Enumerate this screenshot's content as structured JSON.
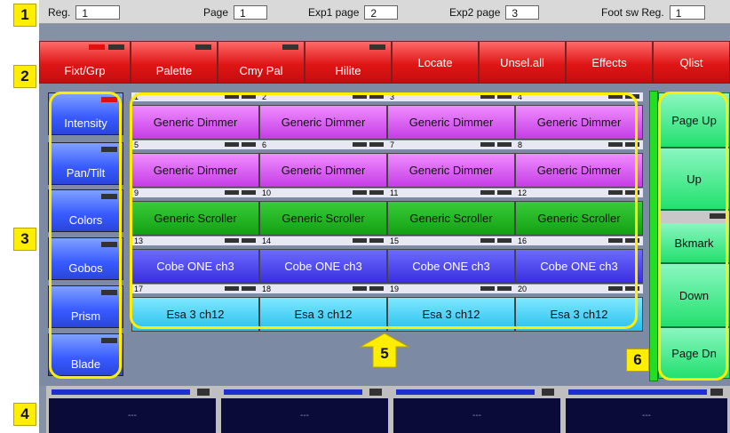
{
  "topbar": {
    "reg_label": "Reg.",
    "reg_value": "1",
    "page_label": "Page",
    "page_value": "1",
    "exp1_label": "Exp1 page",
    "exp1_value": "2",
    "exp2_label": "Exp2 page",
    "exp2_value": "3",
    "foot_label": "Foot sw Reg.",
    "foot_value": "1"
  },
  "buttons": [
    "Fixt/Grp",
    "Palette",
    "Cmy Pal",
    "Hilite",
    "Locate",
    "Unsel.all",
    "Effects",
    "Qlist"
  ],
  "categories": [
    "Intensity",
    "Pan/Tilt",
    "Colors",
    "Gobos",
    "Prism",
    "Blade"
  ],
  "fixtures": [
    {
      "num": "1",
      "label": "Generic Dimmer"
    },
    {
      "num": "2",
      "label": "Generic Dimmer"
    },
    {
      "num": "3",
      "label": "Generic Dimmer"
    },
    {
      "num": "4",
      "label": "Generic Dimmer"
    },
    {
      "num": "5",
      "label": "Generic Dimmer"
    },
    {
      "num": "6",
      "label": "Generic Dimmer"
    },
    {
      "num": "7",
      "label": "Generic Dimmer"
    },
    {
      "num": "8",
      "label": "Generic Dimmer"
    },
    {
      "num": "9",
      "label": "Generic Scroller"
    },
    {
      "num": "10",
      "label": "Generic Scroller"
    },
    {
      "num": "11",
      "label": "Generic Scroller"
    },
    {
      "num": "12",
      "label": "Generic Scroller"
    },
    {
      "num": "13",
      "label": "Cobe ONE ch3"
    },
    {
      "num": "14",
      "label": "Cobe ONE ch3"
    },
    {
      "num": "15",
      "label": "Cobe ONE ch3"
    },
    {
      "num": "16",
      "label": "Cobe ONE ch3"
    },
    {
      "num": "17",
      "label": "Esa 3 ch12"
    },
    {
      "num": "18",
      "label": "Esa 3 ch12"
    },
    {
      "num": "19",
      "label": "Esa 3 ch12"
    },
    {
      "num": "20",
      "label": "Esa 3 ch12"
    }
  ],
  "nav": [
    "Page Up",
    "Up",
    "Bkmark",
    "Down",
    "Page Dn"
  ],
  "faders": [
    "---",
    "---",
    "---",
    "---"
  ],
  "callouts": [
    "1",
    "2",
    "3",
    "4",
    "5",
    "6"
  ],
  "colors": {
    "command_red": "#e01616",
    "category_blue": "#3759ff",
    "nav_green": "#23e06e",
    "highlight_yellow": "#ffee00"
  }
}
